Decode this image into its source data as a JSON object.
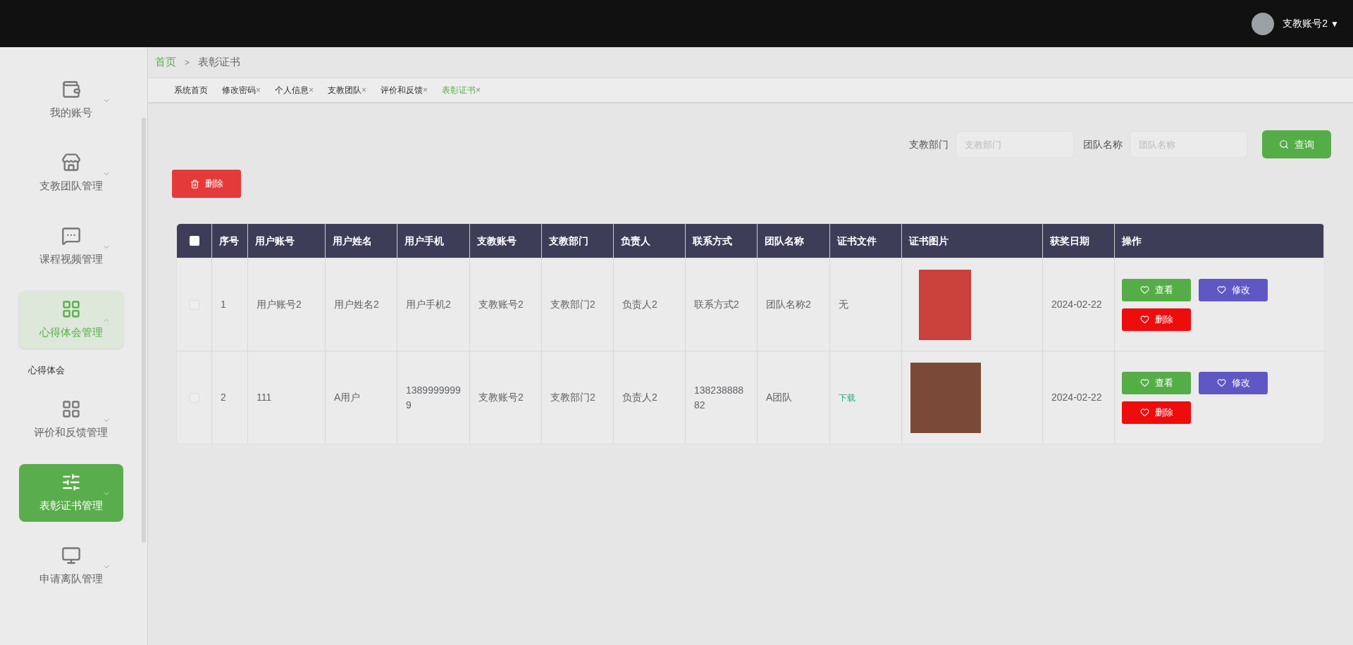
{
  "header": {
    "user": "支教账号2",
    "caret": "▼"
  },
  "sidebar": {
    "items": [
      {
        "label": "我的账号",
        "expanded": false,
        "selected": false
      },
      {
        "label": "支教团队管理",
        "expanded": false,
        "selected": false
      },
      {
        "label": "课程视频管理",
        "expanded": false,
        "selected": false
      },
      {
        "label": "心得体会管理",
        "expanded": true,
        "selected": false,
        "children": [
          {
            "label": "心得体会"
          }
        ]
      },
      {
        "label": "评价和反馈管理",
        "expanded": false,
        "selected": false
      },
      {
        "label": "表彰证书管理",
        "expanded": false,
        "selected": true
      },
      {
        "label": "申请离队管理",
        "expanded": false,
        "selected": false
      }
    ]
  },
  "breadcrumb": {
    "home": "首页",
    "separator": ">",
    "current": "表彰证书"
  },
  "tabs": [
    {
      "label": "系统首页",
      "selected": false
    },
    {
      "label": "修改密码",
      "close": "×",
      "selected": false
    },
    {
      "label": "个人信息",
      "close": "×",
      "selected": false
    },
    {
      "label": "支教团队",
      "close": "×",
      "selected": false
    },
    {
      "label": "评价和反馈",
      "close": "×",
      "selected": false
    },
    {
      "label": "表彰证书",
      "close": "×",
      "selected": true
    }
  ],
  "search": {
    "fields": [
      {
        "label": "支教部门",
        "placeholder": "支教部门"
      },
      {
        "label": "团队名称",
        "placeholder": "团队名称"
      }
    ],
    "button": "查询"
  },
  "delete_button": "删除",
  "table": {
    "header_checked": false,
    "columns": [
      "序号",
      "用户账号",
      "用户姓名",
      "用户手机",
      "支教账号",
      "支教部门",
      "负责人",
      "联系方式",
      "团队名称",
      "证书文件",
      "证书图片",
      "获奖日期",
      "操作"
    ],
    "rows": [
      {
        "checked": false,
        "cells": [
          {
            "kind": "text",
            "text": "1"
          },
          {
            "kind": "text",
            "text": "用户账号2"
          },
          {
            "kind": "text",
            "text": "用户姓名2"
          },
          {
            "kind": "text",
            "text": "用户手机2"
          },
          {
            "kind": "text",
            "text": "支教账号2"
          },
          {
            "kind": "text",
            "text": "支教部门2"
          },
          {
            "kind": "text",
            "text": "负责人2"
          },
          {
            "kind": "text",
            "text": "联系方式2"
          },
          {
            "kind": "text",
            "text": "团队名称2"
          },
          {
            "kind": "text",
            "text": "无"
          },
          {
            "kind": "image"
          },
          {
            "kind": "text",
            "text": "2024-02-22"
          }
        ],
        "actions": [
          {
            "kind": "view",
            "label": "查看"
          },
          {
            "kind": "edit",
            "label": "修改"
          },
          {
            "kind": "delete",
            "label": "删除"
          }
        ]
      },
      {
        "checked": false,
        "cells": [
          {
            "kind": "text",
            "text": "2"
          },
          {
            "kind": "text",
            "text": "111"
          },
          {
            "kind": "text",
            "text": "A用户"
          },
          {
            "kind": "text",
            "text": "13899999999"
          },
          {
            "kind": "text",
            "text": "支教账号2"
          },
          {
            "kind": "text",
            "text": "支教部门2"
          },
          {
            "kind": "text",
            "text": "负责人2"
          },
          {
            "kind": "text",
            "text": "13823888882"
          },
          {
            "kind": "text",
            "text": "A团队"
          },
          {
            "kind": "link",
            "text": "下载"
          },
          {
            "kind": "image"
          },
          {
            "kind": "text",
            "text": "2024-02-22"
          }
        ],
        "actions": [
          {
            "kind": "view",
            "label": "查看"
          },
          {
            "kind": "edit",
            "label": "修改"
          },
          {
            "kind": "delete",
            "label": "删除"
          }
        ]
      }
    ]
  }
}
